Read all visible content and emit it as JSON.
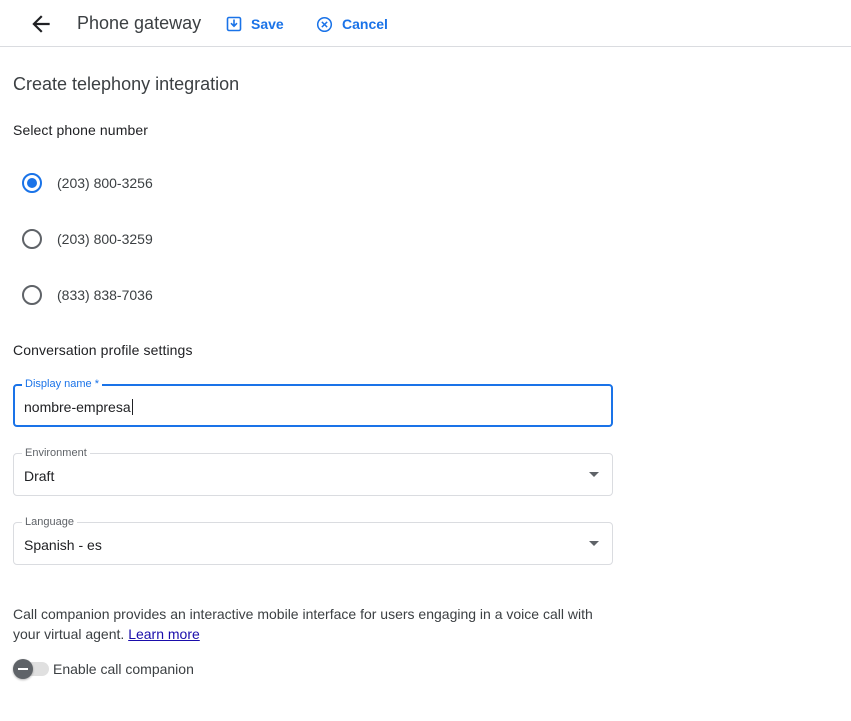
{
  "header": {
    "title": "Phone gateway",
    "back_icon": "arrow-back-icon",
    "save_label": "Save",
    "save_icon": "save-icon",
    "cancel_label": "Cancel",
    "cancel_icon": "cancel-circle-icon"
  },
  "form": {
    "title": "Create telephony integration",
    "phone_section_label": "Select phone number",
    "phone_numbers": [
      {
        "label": "(203) 800-3256",
        "selected": true
      },
      {
        "label": "(203) 800-3259",
        "selected": false
      },
      {
        "label": "(833) 838-7036",
        "selected": false
      }
    ],
    "profile_section_label": "Conversation profile settings",
    "display_name": {
      "label": "Display name *",
      "value": "nombre-empresa"
    },
    "environment": {
      "label": "Environment",
      "value": "Draft"
    },
    "language": {
      "label": "Language",
      "value": "Spanish - es"
    },
    "call_companion": {
      "description": "Call companion provides an interactive mobile interface for users engaging in a voice call with your virtual agent.",
      "learn_more": "Learn more",
      "toggle_label": "Enable call companion",
      "enabled": false
    }
  },
  "colors": {
    "accent": "#1a73e8",
    "text": "#202124",
    "link": "#1a0dab",
    "divider": "#dadce0"
  }
}
